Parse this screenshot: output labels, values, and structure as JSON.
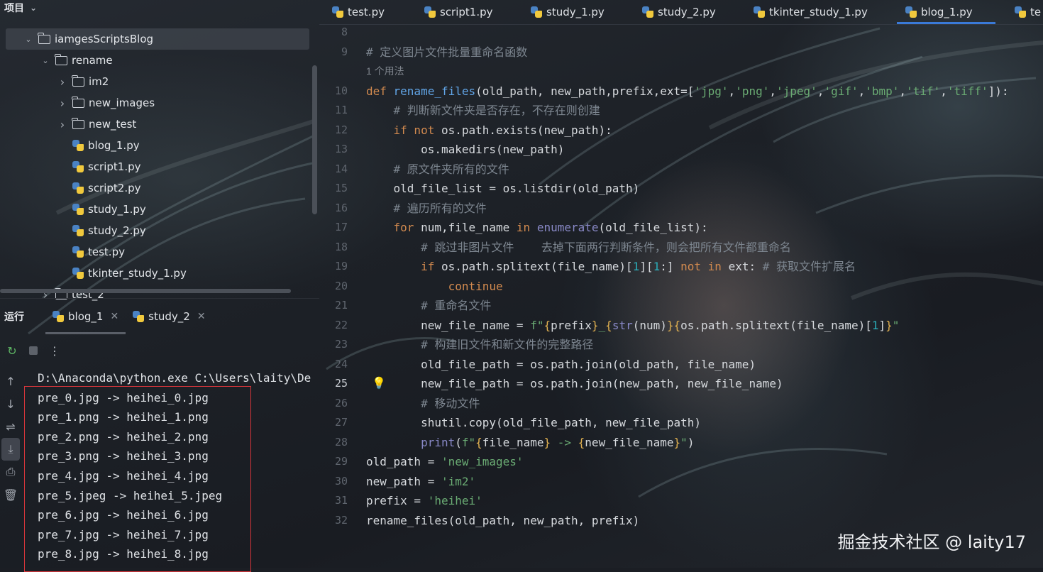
{
  "project_panel": {
    "title": "项目",
    "tree": [
      {
        "label": "iamgesScriptsBlog",
        "kind": "folder",
        "expanded": true,
        "indent": 1,
        "selected": true
      },
      {
        "label": "rename",
        "kind": "folder",
        "expanded": true,
        "indent": 2
      },
      {
        "label": "im2",
        "kind": "folder",
        "expanded": false,
        "indent": 3
      },
      {
        "label": "new_images",
        "kind": "folder",
        "expanded": false,
        "indent": 3
      },
      {
        "label": "new_test",
        "kind": "folder",
        "expanded": false,
        "indent": 3
      },
      {
        "label": "blog_1.py",
        "kind": "python",
        "indent": 3
      },
      {
        "label": "script1.py",
        "kind": "python",
        "indent": 3
      },
      {
        "label": "script2.py",
        "kind": "python",
        "indent": 3
      },
      {
        "label": "study_1.py",
        "kind": "python",
        "indent": 3
      },
      {
        "label": "study_2.py",
        "kind": "python",
        "indent": 3
      },
      {
        "label": "test.py",
        "kind": "python",
        "indent": 3
      },
      {
        "label": "tkinter_study_1.py",
        "kind": "python",
        "indent": 3
      },
      {
        "label": "test_2",
        "kind": "folder",
        "expanded": false,
        "indent": 2
      }
    ]
  },
  "run_panel": {
    "label": "运行",
    "tabs": [
      {
        "label": "blog_1",
        "active": true
      },
      {
        "label": "study_2",
        "active": false
      }
    ],
    "console_lines": [
      "D:\\Anaconda\\python.exe C:\\Users\\laity\\De",
      "pre_0.jpg -> heihei_0.jpg",
      "pre_1.png -> heihei_1.png",
      "pre_2.png -> heihei_2.png",
      "pre_3.png -> heihei_3.png",
      "pre_4.jpg -> heihei_4.jpg",
      "pre_5.jpeg -> heihei_5.jpeg",
      "pre_6.jpg -> heihei_6.jpg",
      "pre_7.jpg -> heihei_7.jpg",
      "pre_8.jpg -> heihei_8.jpg"
    ]
  },
  "editor": {
    "tabs": [
      {
        "label": "test.py",
        "active": false
      },
      {
        "label": "script1.py",
        "active": false
      },
      {
        "label": "study_1.py",
        "active": false
      },
      {
        "label": "study_2.py",
        "active": false
      },
      {
        "label": "tkinter_study_1.py",
        "active": false
      },
      {
        "label": "blog_1.py",
        "active": true
      },
      {
        "label": "te",
        "active": false
      }
    ],
    "current_line": "25",
    "usage_hint": "1 个用法",
    "lines": [
      {
        "n": "8",
        "tokens": []
      },
      {
        "n": "9",
        "tokens": [
          [
            "cm",
            "# 定义图片文件批量重命名函数"
          ]
        ]
      },
      {
        "n": "",
        "usage": true
      },
      {
        "n": "10",
        "tokens": [
          [
            "kw",
            "def "
          ],
          [
            "fn",
            "rename_files"
          ],
          [
            "tx",
            "(old_path, new_path,prefix,ext=["
          ],
          [
            "st",
            "'jpg'"
          ],
          [
            "tx",
            ","
          ],
          [
            "st",
            "'png'"
          ],
          [
            "tx",
            ","
          ],
          [
            "st",
            "'jpeg'"
          ],
          [
            "tx",
            ","
          ],
          [
            "st",
            "'gif'"
          ],
          [
            "tx",
            ","
          ],
          [
            "st",
            "'bmp'"
          ],
          [
            "tx",
            ","
          ],
          [
            "st",
            "'tif'"
          ],
          [
            "tx",
            ","
          ],
          [
            "st",
            "'tiff'"
          ],
          [
            "tx",
            "]):"
          ]
        ]
      },
      {
        "n": "11",
        "tokens": [
          [
            "tx",
            "    "
          ],
          [
            "cm",
            "# 判断新文件夹是否存在，不存在则创建"
          ]
        ]
      },
      {
        "n": "12",
        "tokens": [
          [
            "tx",
            "    "
          ],
          [
            "kw",
            "if not "
          ],
          [
            "tx",
            "os.path.exists(new_path):"
          ]
        ]
      },
      {
        "n": "13",
        "tokens": [
          [
            "tx",
            "        os.makedirs(new_path)"
          ]
        ]
      },
      {
        "n": "14",
        "tokens": [
          [
            "tx",
            "    "
          ],
          [
            "cm",
            "# 原文件夹所有的文件"
          ]
        ]
      },
      {
        "n": "15",
        "tokens": [
          [
            "tx",
            "    old_file_list = os.listdir(old_path)"
          ]
        ]
      },
      {
        "n": "16",
        "tokens": [
          [
            "tx",
            "    "
          ],
          [
            "cm",
            "# 遍历所有的文件"
          ]
        ]
      },
      {
        "n": "17",
        "tokens": [
          [
            "tx",
            "    "
          ],
          [
            "kw",
            "for "
          ],
          [
            "tx",
            "num,file_name "
          ],
          [
            "kw",
            "in "
          ],
          [
            "bi",
            "enumerate"
          ],
          [
            "tx",
            "(old_file_list):"
          ]
        ]
      },
      {
        "n": "18",
        "tokens": [
          [
            "tx",
            "        "
          ],
          [
            "cm",
            "# 跳过非图片文件    去掉下面两行判断条件，则会把所有文件都重命名"
          ]
        ]
      },
      {
        "n": "19",
        "tokens": [
          [
            "tx",
            "        "
          ],
          [
            "kw",
            "if "
          ],
          [
            "tx",
            "os.path.splitext(file_name)["
          ],
          [
            "nm",
            "1"
          ],
          [
            "tx",
            "]["
          ],
          [
            "nm",
            "1"
          ],
          [
            "tx",
            ":] "
          ],
          [
            "kw",
            "not in "
          ],
          [
            "tx",
            "ext: "
          ],
          [
            "cm",
            "# 获取文件扩展名"
          ]
        ]
      },
      {
        "n": "20",
        "tokens": [
          [
            "tx",
            "            "
          ],
          [
            "kw",
            "continue"
          ]
        ]
      },
      {
        "n": "21",
        "tokens": [
          [
            "tx",
            "        "
          ],
          [
            "cm",
            "# 重命名文件"
          ]
        ]
      },
      {
        "n": "22",
        "tokens": [
          [
            "tx",
            "        new_file_name = "
          ],
          [
            "st",
            "f\""
          ],
          [
            "br",
            "{"
          ],
          [
            "tx",
            "prefix"
          ],
          [
            "br",
            "}"
          ],
          [
            "st",
            "_"
          ],
          [
            "br",
            "{"
          ],
          [
            "bi",
            "str"
          ],
          [
            "tx",
            "(num)"
          ],
          [
            "br",
            "}{"
          ],
          [
            "tx",
            "os.path.splitext(file_name)["
          ],
          [
            "nm",
            "1"
          ],
          [
            "tx",
            "]"
          ],
          [
            "br",
            "}"
          ],
          [
            "st",
            "\""
          ]
        ]
      },
      {
        "n": "23",
        "tokens": [
          [
            "tx",
            "        "
          ],
          [
            "cm",
            "# 构建旧文件和新文件的完整路径"
          ]
        ]
      },
      {
        "n": "24",
        "tokens": [
          [
            "tx",
            "        old_file_path = os.path.join(old_path, file_name)"
          ]
        ]
      },
      {
        "n": "25",
        "tokens": [
          [
            "tx",
            "        new_file_path = os.path.join(new_path, new_file_name)"
          ]
        ]
      },
      {
        "n": "26",
        "tokens": [
          [
            "tx",
            "        "
          ],
          [
            "cm",
            "# 移动文件"
          ]
        ]
      },
      {
        "n": "27",
        "tokens": [
          [
            "tx",
            "        shutil.copy(old_file_path, new_file_path)"
          ]
        ]
      },
      {
        "n": "28",
        "tokens": [
          [
            "tx",
            "        "
          ],
          [
            "bi",
            "print"
          ],
          [
            "tx",
            "("
          ],
          [
            "st",
            "f\""
          ],
          [
            "br",
            "{"
          ],
          [
            "tx",
            "file_name"
          ],
          [
            "br",
            "}"
          ],
          [
            "st",
            " -> "
          ],
          [
            "br",
            "{"
          ],
          [
            "tx",
            "new_file_name"
          ],
          [
            "br",
            "}"
          ],
          [
            "st",
            "\""
          ],
          [
            "tx",
            ")"
          ]
        ]
      },
      {
        "n": "29",
        "tokens": [
          [
            "tx",
            "old_path = "
          ],
          [
            "st",
            "'new_images'"
          ]
        ]
      },
      {
        "n": "30",
        "tokens": [
          [
            "tx",
            "new_path = "
          ],
          [
            "st",
            "'im2'"
          ]
        ]
      },
      {
        "n": "31",
        "tokens": [
          [
            "tx",
            "prefix = "
          ],
          [
            "st",
            "'heihei'"
          ]
        ]
      },
      {
        "n": "32",
        "tokens": [
          [
            "tx",
            "rename_files(old_path, new_path, prefix)"
          ]
        ]
      }
    ]
  },
  "watermark": "掘金技术社区 @ laity17",
  "colors": {
    "keyword": "#d28a4f",
    "function": "#62a6e8",
    "comment": "#7d8690",
    "string": "#6aab73",
    "number": "#2aacb8",
    "builtin": "#8888c6",
    "highlight_box": "#d8363b",
    "active_tab": "#3a7ad8"
  }
}
